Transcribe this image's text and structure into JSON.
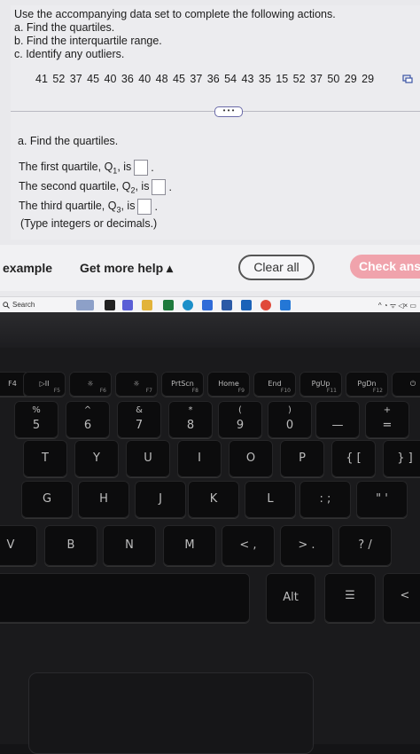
{
  "problem": {
    "instructions": [
      "Use the accompanying data set to complete the following actions.",
      "a. Find the quartiles.",
      "b. Find the interquartile range.",
      "c. Identify any outliers."
    ],
    "dataset_values": "41  52  37  45  40  36  40  48  45  37  36  54  43  35  15  52  37  50  29  29",
    "expand_label": "• • •",
    "part_a_title": "a. Find the quartiles.",
    "q1_prefix": "The first quartile, Q",
    "q1_sub": "1",
    "q1_suffix": ", is",
    "q2_prefix": "The second quartile, Q",
    "q2_sub": "2",
    "q2_suffix": ", is",
    "q3_prefix": "The third quartile, Q",
    "q3_sub": "3",
    "q3_suffix": ", is",
    "q_end": ".",
    "answer_values": {
      "q1": "",
      "q2": "",
      "q3": ""
    },
    "note": "(Type integers or decimals.)"
  },
  "footer": {
    "example_label": "example",
    "help_label": "Get more help ▴",
    "clear_label": "Clear all",
    "check_label": "Check ans"
  },
  "taskbar": {
    "search_label": "Search",
    "tray_text": "^ ◔ ᯤ ◁× ▭"
  },
  "keyboard": {
    "fn_row": [
      {
        "label": "F4",
        "sub": ""
      },
      {
        "label": "▷II",
        "sub": "F5"
      },
      {
        "label": "☼",
        "sub": "F6"
      },
      {
        "label": "☼",
        "sub": "F7"
      },
      {
        "label": "PrtScn",
        "sub": "F8"
      },
      {
        "label": "Home",
        "sub": "F9"
      },
      {
        "label": "End",
        "sub": "F10"
      },
      {
        "label": "PgUp",
        "sub": "F11"
      },
      {
        "label": "PgDn",
        "sub": "F12"
      },
      {
        "label": "⏻",
        "sub": ""
      }
    ],
    "num_row": [
      {
        "top": "%",
        "main": "5"
      },
      {
        "top": "^",
        "main": "6"
      },
      {
        "top": "&",
        "main": "7"
      },
      {
        "top": "*",
        "main": "8"
      },
      {
        "top": "(",
        "main": "9"
      },
      {
        "top": ")",
        "main": "0"
      },
      {
        "top": "",
        "main": "—"
      },
      {
        "top": "+",
        "main": "="
      }
    ],
    "row_t": [
      "T",
      "Y",
      "U",
      "I",
      "O",
      "P",
      "{ [",
      "} ]"
    ],
    "row_g": [
      "G",
      "H",
      "J",
      "K",
      "L",
      ": ;",
      "\" '"
    ],
    "row_b": [
      "V",
      "B",
      "N",
      "M",
      "< ,",
      "> .",
      "? /"
    ],
    "alt_label": "Alt",
    "menu_label": "☰",
    "arrow_left": "<"
  }
}
